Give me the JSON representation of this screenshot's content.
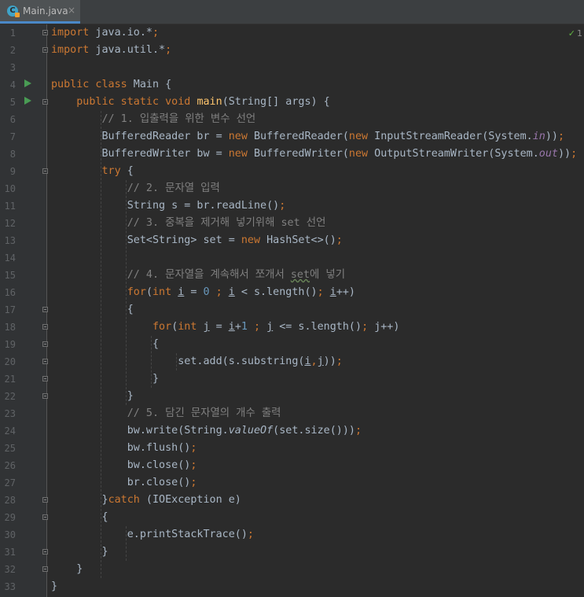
{
  "tab": {
    "icon": "java-class-icon",
    "filename": "Main.java",
    "close": "×"
  },
  "inspection": {
    "icon": "check-icon",
    "mark": "✓",
    "count": "1"
  },
  "line_numbers": [
    "1",
    "2",
    "3",
    "4",
    "5",
    "6",
    "7",
    "8",
    "9",
    "10",
    "11",
    "12",
    "13",
    "14",
    "15",
    "16",
    "17",
    "18",
    "19",
    "20",
    "21",
    "22",
    "23",
    "24",
    "25",
    "26",
    "27",
    "28",
    "29",
    "30",
    "31",
    "32",
    "33"
  ],
  "code": {
    "l1": [
      "import",
      " java.io.*",
      ";"
    ],
    "l2": [
      "import",
      " java.util.*",
      ";"
    ],
    "l4": [
      "public class",
      " Main {"
    ],
    "l5": [
      "    ",
      "public static void",
      " ",
      "main",
      "(String[] args) {"
    ],
    "l6": [
      "        ",
      "// 1. 입출력을 위한 변수 선언"
    ],
    "l7": [
      "        BufferedReader br = ",
      "new",
      " BufferedReader(",
      "new",
      " InputStreamReader(System.",
      "in",
      "))",
      ";"
    ],
    "l8": [
      "        BufferedWriter bw = ",
      "new",
      " BufferedWriter(",
      "new",
      " OutputStreamWriter(System.",
      "out",
      "))",
      ";"
    ],
    "l9": [
      "        ",
      "try",
      " {"
    ],
    "l10": [
      "            ",
      "// 2. 문자열 입력"
    ],
    "l11": [
      "            String s = br.readLine()",
      ";"
    ],
    "l12": [
      "            ",
      "// 3. 중복을 제거해 넣기위해 set 선언"
    ],
    "l13": [
      "            Set<String> set = ",
      "new",
      " HashSet<>()",
      ";"
    ],
    "l15": [
      "            ",
      "// 4. 문자열을 계속해서 쪼개서 ",
      "set",
      "에 넣기"
    ],
    "l16": [
      "            ",
      "for",
      "(",
      "int ",
      "i",
      " = ",
      "0",
      " ; ",
      "i",
      " < s.length()",
      "; ",
      "i",
      "++)"
    ],
    "l17": [
      "            {"
    ],
    "l18": [
      "                ",
      "for",
      "(",
      "int ",
      "j",
      " = ",
      "i",
      "+",
      "1",
      " ; ",
      "j",
      " <= s.length()",
      "; ",
      "j++)"
    ],
    "l19": [
      "                {"
    ],
    "l20": [
      "                    set.add(s.substring(",
      "i",
      ",",
      "j",
      "))",
      ";"
    ],
    "l21": [
      "                }"
    ],
    "l22": [
      "            }"
    ],
    "l23": [
      "            ",
      "// 5. 담긴 문자열의 개수 출력"
    ],
    "l24": [
      "            bw.write(String.",
      "valueOf",
      "(set.size()))",
      ";"
    ],
    "l25": [
      "            bw.flush()",
      ";"
    ],
    "l26": [
      "            bw.close()",
      ";"
    ],
    "l27": [
      "            br.close()",
      ";"
    ],
    "l28": [
      "        }",
      "catch",
      " (IOException e)"
    ],
    "l29": [
      "        {"
    ],
    "l30": [
      "            e.printStackTrace()",
      ";"
    ],
    "l31": [
      "        }"
    ],
    "l32": [
      "    }"
    ],
    "l33": [
      "}"
    ]
  }
}
